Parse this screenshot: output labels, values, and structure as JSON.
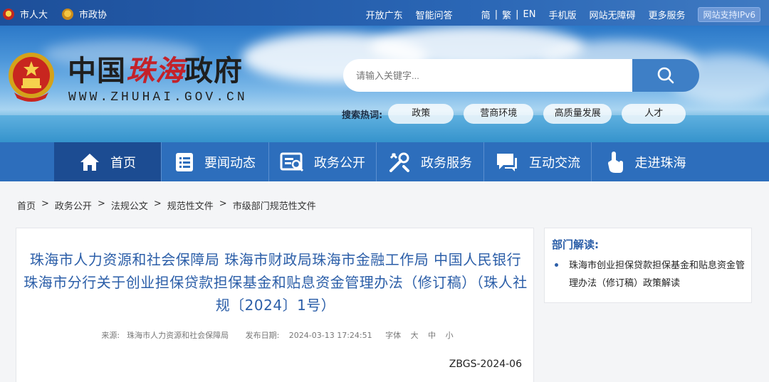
{
  "topbar": {
    "left_links": [
      {
        "label": "市人大",
        "icon": "emblem-icon"
      },
      {
        "label": "市政协",
        "icon": "emblem-icon"
      }
    ],
    "right_links": [
      "开放广东",
      "智能问答"
    ],
    "languages": [
      "简",
      "繁",
      "EN"
    ],
    "more_links": [
      "手机版",
      "网站无障碍",
      "更多服务"
    ],
    "ipv6_badge": "网站支持IPv6"
  },
  "header": {
    "title_black_1": "中国",
    "title_red": "珠海",
    "title_black_2": "政府",
    "domain": "WWW.ZHUHAI.GOV.CN",
    "search_placeholder": "请输入关键字...",
    "hot_label": "搜索热词:",
    "hot_tags": [
      "政策",
      "营商环境",
      "高质量发展",
      "人才"
    ]
  },
  "nav": {
    "items": [
      {
        "label": "首页",
        "icon": "home-icon"
      },
      {
        "label": "要闻动态",
        "icon": "news-list-icon"
      },
      {
        "label": "政务公开",
        "icon": "disclosure-icon"
      },
      {
        "label": "政务服务",
        "icon": "service-tools-icon"
      },
      {
        "label": "互动交流",
        "icon": "chat-icon"
      },
      {
        "label": "走进珠海",
        "icon": "pointer-hand-icon"
      }
    ]
  },
  "breadcrumb": [
    "首页",
    "政务公开",
    "法规公文",
    "规范性文件",
    "市级部门规范性文件"
  ],
  "article": {
    "title": "珠海市人力资源和社会保障局 珠海市财政局珠海市金融工作局 中国人民银行珠海市分行关于创业担保贷款担保基金和贴息资金管理办法（修订稿）（珠人社规〔2024〕1号）",
    "source_label": "来源:",
    "source": "珠海市人力资源和社会保障局",
    "date_label": "发布日期:",
    "date": "2024-03-13 17:24:51",
    "font_label": "字体",
    "font_sizes": [
      "大",
      "中",
      "小"
    ],
    "doc_number": "ZBGS-2024-06"
  },
  "side_panel": {
    "heading": "部门解读:",
    "link": "珠海市创业担保贷款担保基金和贴息资金管理办法（修订稿）政策解读"
  },
  "colors": {
    "nav_blue": "#2d6ebc",
    "nav_active": "#1c4c92",
    "title_blue": "#2b5ea8",
    "brand_red": "#c3222a"
  }
}
